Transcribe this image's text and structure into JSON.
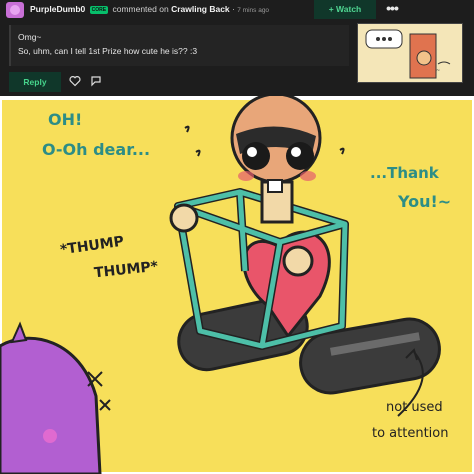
{
  "comment": {
    "username": "PurpleDumb0",
    "badge": "CORE",
    "action": "commented on",
    "deviation_title": "Crawling Back",
    "timestamp": "7 mins ago",
    "body_lines": [
      "Omg~",
      "So, uhm, can I tell 1st Prize how cute he is?? :3"
    ],
    "watch_label": "+ Watch",
    "more_label": "•••",
    "reply_label": "Reply",
    "icons": [
      "heart-icon",
      "flag-icon",
      "more-icon"
    ]
  },
  "artwork": {
    "texts": {
      "oh": "OH!",
      "ohdear": "O-Oh dear...",
      "thankyou1": "...Thank",
      "thankyou2": "You!~",
      "thump1": "*THUMP",
      "thump2": "THUMP*",
      "note1": "not used",
      "note2": "to attention"
    }
  },
  "colors": {
    "panel_bg": "#1d1d1d",
    "accent_green": "#07bf6b",
    "art_background": "#f7df5a",
    "cage_teal": "#4dbfa8",
    "heart_red": "#e9556a",
    "text_teal": "#2d8d86",
    "purple_character": "#b25fd1"
  }
}
